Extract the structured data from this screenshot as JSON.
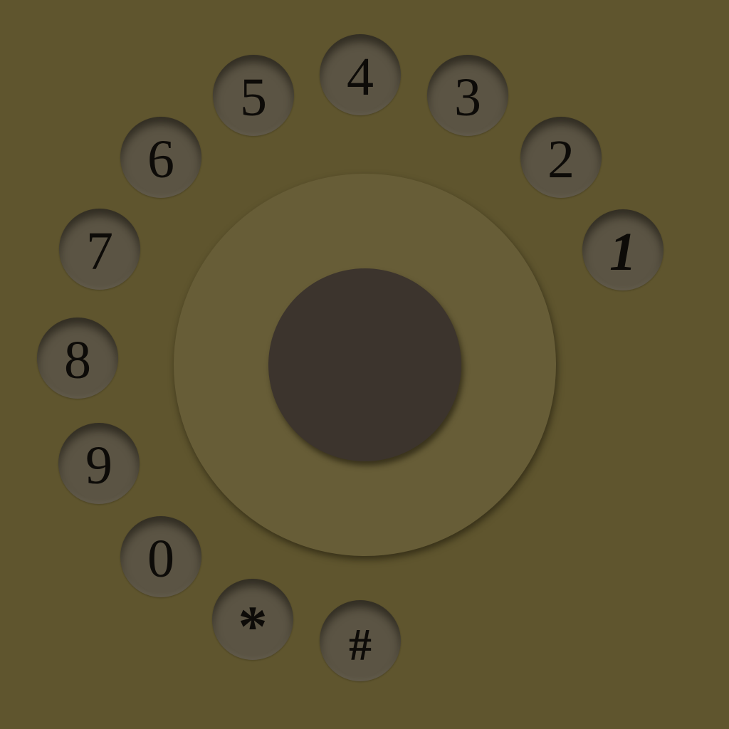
{
  "dial": {
    "keys": [
      {
        "id": "1",
        "label": "1"
      },
      {
        "id": "2",
        "label": "2"
      },
      {
        "id": "3",
        "label": "3"
      },
      {
        "id": "4",
        "label": "4"
      },
      {
        "id": "5",
        "label": "5"
      },
      {
        "id": "6",
        "label": "6"
      },
      {
        "id": "7",
        "label": "7"
      },
      {
        "id": "8",
        "label": "8"
      },
      {
        "id": "9",
        "label": "9"
      },
      {
        "id": "0",
        "label": "0"
      },
      {
        "id": "star",
        "label": "*"
      },
      {
        "id": "hash",
        "label": "#"
      }
    ]
  },
  "colors": {
    "background": "#5f552e",
    "finger_plate": "#675d37",
    "center_hub": "#3c342d",
    "hole": "#5b5444",
    "digit": "#0d0b08"
  }
}
